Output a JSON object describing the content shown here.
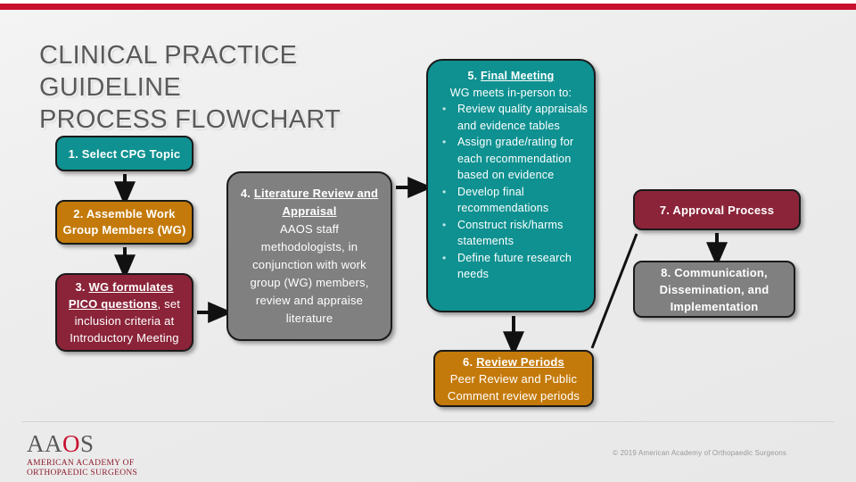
{
  "slide": {
    "title": "CLINICAL PRACTICE GUIDELINE\nPROCESS FLOWCHART",
    "background_color": "#ececec",
    "accent_color": "#c8102e"
  },
  "colors": {
    "teal": "#0f9191",
    "orange": "#c47a0a",
    "maroon": "#8b2439",
    "gray": "#808080",
    "crimson": "#c8102e",
    "title_gray": "#595959"
  },
  "flowchart": {
    "box1": {
      "number": "1.",
      "label": "1. Select CPG Topic",
      "color": "#0f9191"
    },
    "box2": {
      "number": "2.",
      "label": "2. Assemble Work Group Members (WG)",
      "color": "#c47a0a"
    },
    "box3": {
      "number": "3.",
      "heading": "WG formulates PICO questions",
      "heading_prefix": "3. ",
      "body": ", set inclusion criteria at Introductory Meeting",
      "color": "#8b2439"
    },
    "box4": {
      "number": "4.",
      "heading": "Literature Review and Appraisal",
      "heading_prefix": "4. ",
      "body": "AAOS staff methodologists, in conjunction with work group (WG) members, review and appraise literature",
      "color": "#808080"
    },
    "box5": {
      "number": "5.",
      "heading": "Final Meeting",
      "heading_prefix": "5. ",
      "lead": "WG meets in-person to:",
      "bullets": [
        "Review quality appraisals and evidence tables",
        "Assign grade/rating for each recommendation based on evidence",
        "Develop final recommendations",
        "Construct risk/harms statements",
        "Define future research needs"
      ],
      "color": "#0f9191"
    },
    "box6": {
      "number": "6.",
      "heading": "Review Periods",
      "heading_prefix": "6. ",
      "body": "Peer Review and Public Comment review periods",
      "color": "#c47a0a"
    },
    "box7": {
      "number": "7.",
      "label": "7. Approval Process",
      "color": "#8b2439"
    },
    "box8": {
      "number": "8.",
      "label": "8. Communication, Dissemination, and Implementation",
      "color": "#808080"
    }
  },
  "logo": {
    "wordmark_part1": "AA",
    "wordmark_o": "O",
    "wordmark_part2": "S",
    "tagline": "AMERICAN ACADEMY OF\nORTHOPAEDIC SURGEONS"
  },
  "footer": {
    "copyright": "© 2019 American Academy of Orthopaedic Surgeons"
  }
}
